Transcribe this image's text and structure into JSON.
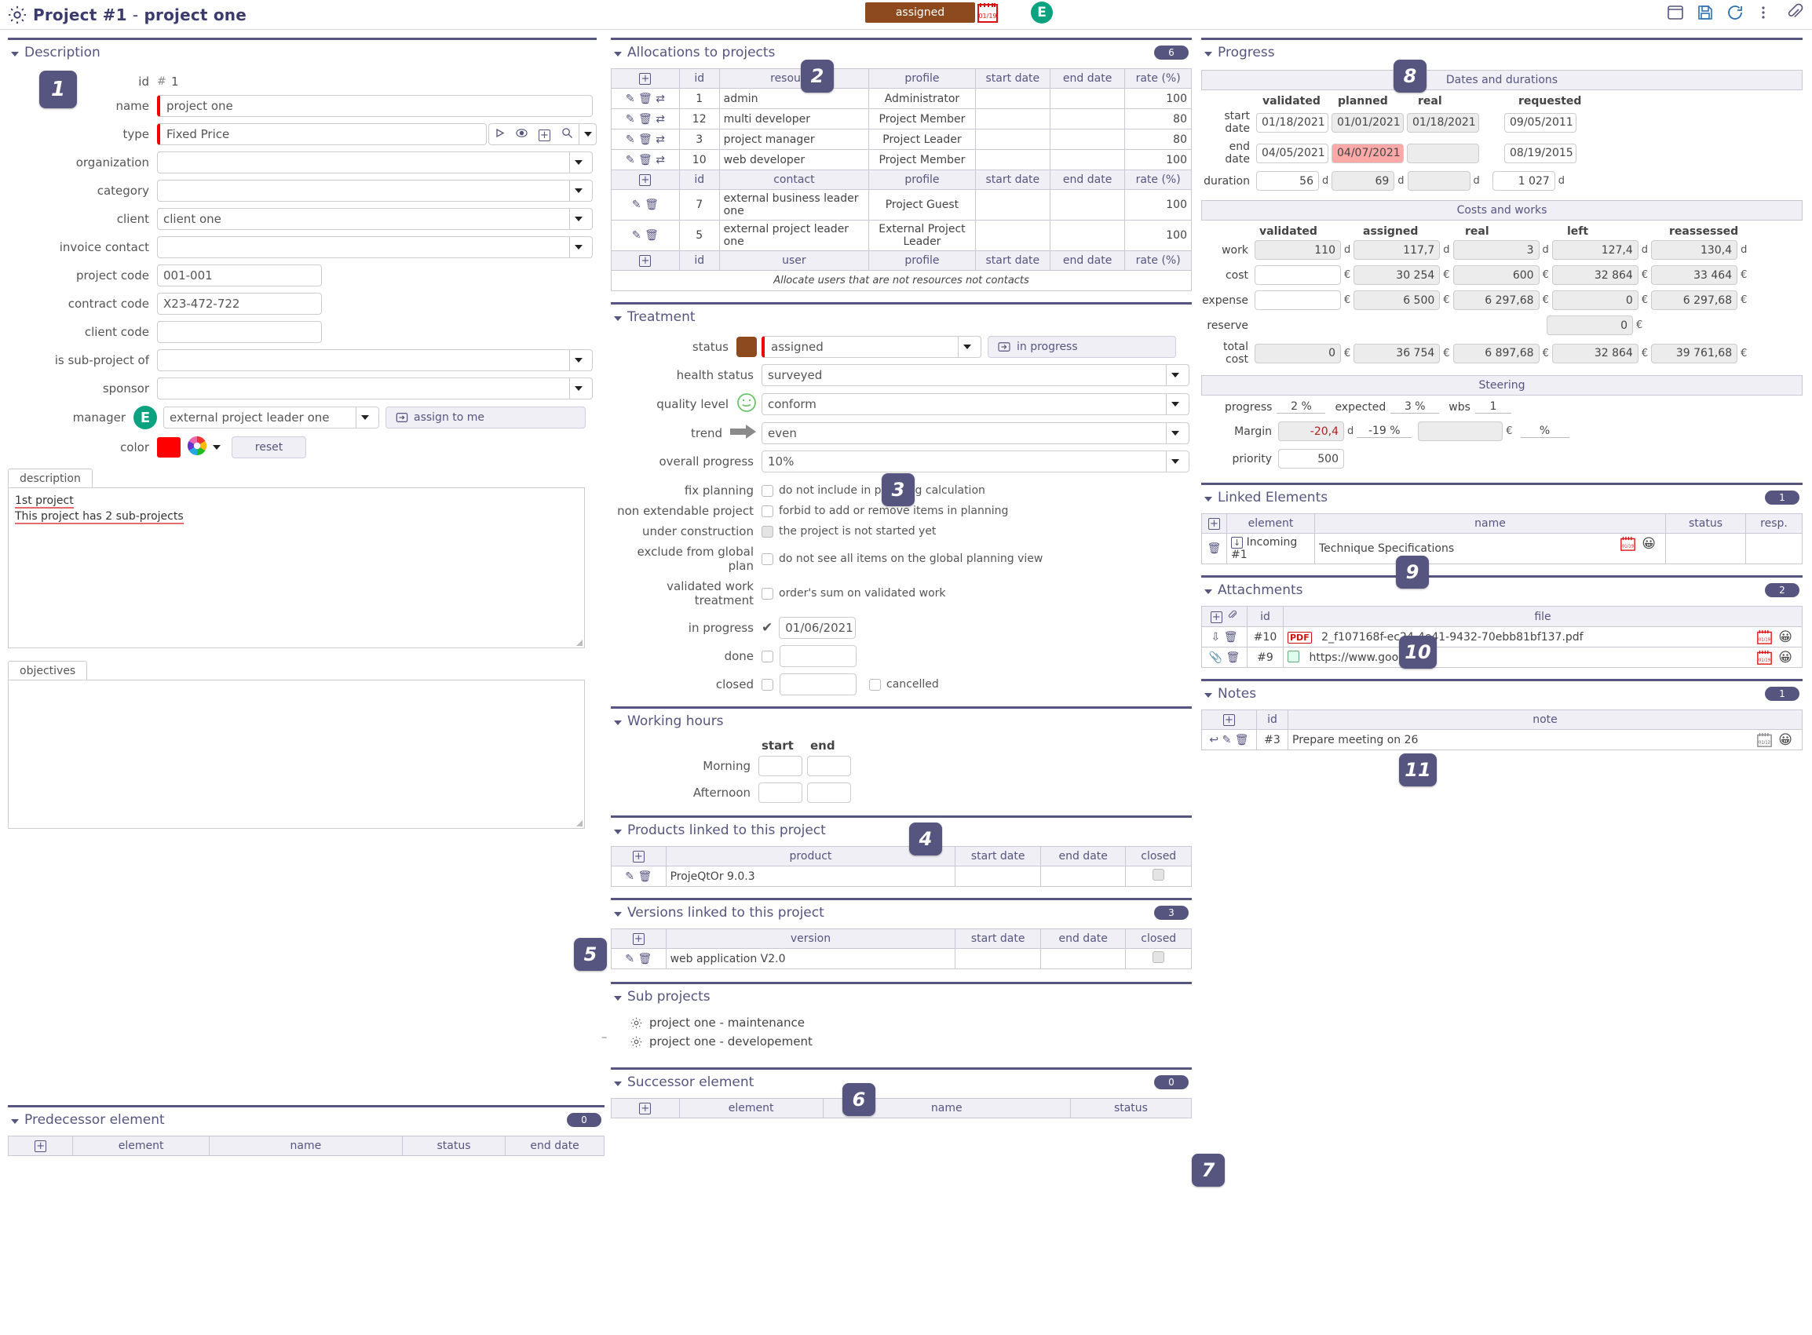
{
  "titlebar": {
    "title_main": "Project  #1",
    "title_sep": "-",
    "title_name": "project one",
    "status_chip": "assigned",
    "calendar_icon": "calendar-icon",
    "calendar_label": "01/19\n2021",
    "avatar_initial": "E",
    "icons": [
      "new-window-icon",
      "save-icon",
      "refresh-icon",
      "more-icon",
      "attach-icon"
    ]
  },
  "description": {
    "section_title": "Description",
    "step": "1",
    "id_label": "id",
    "id_hash": "#",
    "id_value": "1",
    "fields": [
      {
        "label": "name",
        "value": "project one",
        "required": true
      },
      {
        "label": "type",
        "value": "Fixed Price",
        "required": true
      },
      {
        "label": "organization",
        "value": ""
      },
      {
        "label": "category",
        "value": ""
      },
      {
        "label": "client",
        "value": "client one"
      },
      {
        "label": "invoice contact",
        "value": ""
      },
      {
        "label": "project code",
        "value": "001-001"
      },
      {
        "label": "contract code",
        "value": "X23-472-722"
      },
      {
        "label": "client code",
        "value": ""
      },
      {
        "label": "is sub-project of",
        "value": ""
      },
      {
        "label": "sponsor",
        "value": ""
      }
    ],
    "manager_label": "manager",
    "manager_avatar": "E",
    "manager_value": "external project leader one",
    "assign_to_me": "assign to me",
    "color_label": "color",
    "color_value": "#fe0000",
    "reset_label": "reset",
    "desc_tab": "description",
    "desc_line1": "1st project",
    "desc_line2": "This project has 2 sub-projects",
    "objectives_tab": "objectives",
    "objectives_text": ""
  },
  "allocations": {
    "section_title": "Allocations to projects",
    "step": "2",
    "count": "6",
    "resource_headers": [
      "",
      "id",
      "resource",
      "profile",
      "start date",
      "end date",
      "rate (%)"
    ],
    "resources": [
      {
        "id": "1",
        "name": "admin",
        "profile": "Administrator",
        "start": "",
        "end": "",
        "rate": "100"
      },
      {
        "id": "12",
        "name": "multi developer",
        "profile": "Project Member",
        "start": "",
        "end": "",
        "rate": "80"
      },
      {
        "id": "3",
        "name": "project manager",
        "profile": "Project Leader",
        "start": "",
        "end": "",
        "rate": "80"
      },
      {
        "id": "10",
        "name": "web developer",
        "profile": "Project Member",
        "start": "",
        "end": "",
        "rate": "100"
      }
    ],
    "contact_headers": [
      "",
      "id",
      "contact",
      "profile",
      "start date",
      "end date",
      "rate (%)"
    ],
    "contacts": [
      {
        "id": "7",
        "name": "external business leader one",
        "profile": "Project Guest",
        "start": "",
        "end": "",
        "rate": "100"
      },
      {
        "id": "5",
        "name": "external project leader one",
        "profile": "External Project Leader",
        "start": "",
        "end": "",
        "rate": "100"
      }
    ],
    "user_headers": [
      "",
      "id",
      "user",
      "profile",
      "start date",
      "end date",
      "rate (%)"
    ],
    "user_hint": "Allocate users that are not resources not contacts"
  },
  "treatment": {
    "section_title": "Treatment",
    "step": "3",
    "status_label": "status",
    "status_color": "#8c4a1e",
    "status_value": "assigned",
    "in_progress_chip": "in progress",
    "health_label": "health status",
    "health_value": "surveyed",
    "quality_label": "quality level",
    "quality_value": "conform",
    "trend_label": "trend",
    "trend_value": "even",
    "overall_label": "overall progress",
    "overall_value": "10%",
    "checks": [
      {
        "label": "fix planning",
        "text": "do not include in planning calculation",
        "checked": false,
        "grey": false
      },
      {
        "label": "non extendable project",
        "text": "forbid to add or remove items in planning",
        "checked": false,
        "grey": false
      },
      {
        "label": "under construction",
        "text": "the project is not started yet",
        "checked": false,
        "grey": true
      },
      {
        "label": "exclude from global plan",
        "text": "do not see all items on the global planning view",
        "checked": false,
        "grey": false
      },
      {
        "label": "validated work treatment",
        "text": "order's sum on validated work",
        "checked": false,
        "grey": false
      }
    ],
    "in_progress_label": "in progress",
    "in_progress_date": "01/06/2021",
    "in_progress_checked": true,
    "done_label": "done",
    "done_date": "",
    "closed_label": "closed",
    "closed_date": "",
    "cancelled_label": "cancelled"
  },
  "working_hours": {
    "section_title": "Working hours",
    "step": "4",
    "col_start": "start",
    "col_end": "end",
    "rows": [
      {
        "label": "Morning",
        "start": "",
        "end": ""
      },
      {
        "label": "Afternoon",
        "start": "",
        "end": ""
      }
    ]
  },
  "products": {
    "section_title": "Products linked to this project",
    "step": "5",
    "headers": [
      "",
      "product",
      "start date",
      "end date",
      "closed"
    ],
    "rows": [
      {
        "product": "ProjeQtOr 9.0.3",
        "start": "",
        "end": "",
        "closed": false
      }
    ]
  },
  "versions": {
    "section_title": "Versions linked to this project",
    "count": "3",
    "headers": [
      "",
      "version",
      "start date",
      "end date",
      "closed"
    ],
    "rows": [
      {
        "version": "web application V2.0",
        "start": "",
        "end": "",
        "closed": false
      }
    ]
  },
  "subprojects": {
    "section_title": "Sub projects",
    "step": "6",
    "items": [
      "project one - maintenance",
      "project one - developement"
    ]
  },
  "predecessor": {
    "section_title": "Predecessor element",
    "count": "0",
    "headers": [
      "",
      "element",
      "name",
      "status",
      "end date"
    ]
  },
  "successor": {
    "section_title": "Successor element",
    "step": "7",
    "count": "0",
    "headers": [
      "",
      "element",
      "name",
      "status"
    ]
  },
  "progress": {
    "section_title": "Progress",
    "step": "8",
    "dates_title": "Dates and durations",
    "dates_cols": [
      "validated",
      "planned",
      "real",
      "requested"
    ],
    "dates_rows": [
      {
        "label": "start date",
        "validated": "01/18/2021",
        "planned": "01/01/2021",
        "real": "01/18/2021",
        "requested": "09/05/2011",
        "planned_alert": false
      },
      {
        "label": "end date",
        "validated": "04/05/2021",
        "planned": "04/07/2021",
        "real": "",
        "requested": "08/19/2015",
        "planned_alert": true
      },
      {
        "label": "duration",
        "validated": "56",
        "planned": "69",
        "real": "",
        "requested": "1 027",
        "planned_alert": false,
        "unit": "d"
      }
    ],
    "costs_title": "Costs and works",
    "costs_cols": [
      "validated",
      "assigned",
      "real",
      "left",
      "reassessed"
    ],
    "costs_rows": [
      {
        "label": "work",
        "unit": "d",
        "validated": "110",
        "assigned": "117,7",
        "real": "3",
        "left": "127,4",
        "reassessed": "130,4",
        "validated_grey": true
      },
      {
        "label": "cost",
        "unit": "€",
        "validated": "",
        "assigned": "30 254",
        "real": "600",
        "left": "32 864",
        "reassessed": "33 464",
        "validated_grey": false
      },
      {
        "label": "expense",
        "unit": "€",
        "validated": "",
        "assigned": "6 500",
        "real": "6 297,68",
        "left": "0",
        "reassessed": "6 297,68",
        "validated_grey": false
      },
      {
        "label": "reserve",
        "unit": "€",
        "validated": null,
        "assigned": null,
        "real": null,
        "left": "0",
        "reassessed": null,
        "validated_grey": false
      },
      {
        "label": "total cost",
        "unit": "€",
        "validated": "0",
        "assigned": "36 754",
        "real": "6 897,68",
        "left": "32 864",
        "reassessed": "39 761,68",
        "validated_grey": true
      }
    ],
    "steering_title": "Steering",
    "progress_label": "progress",
    "progress_value": "2 %",
    "expected_label": "expected",
    "expected_value": "3 %",
    "wbs_label": "wbs",
    "wbs_value": "1",
    "margin_label": "Margin",
    "margin_days": "-20,4",
    "margin_days_unit": "d",
    "margin_pct": "-19 %",
    "margin_money": "",
    "margin_money_unit": "€",
    "margin_pct2_unit": "%",
    "priority_label": "priority",
    "priority_value": "500"
  },
  "linked_elements": {
    "section_title": "Linked Elements",
    "step": "9",
    "count": "1",
    "headers": [
      "",
      "element",
      "name",
      "status",
      "resp."
    ],
    "rows": [
      {
        "element": "Incoming #1",
        "name": "Technique Specifications",
        "date_badge": "01/19",
        "status": "",
        "resp": ""
      }
    ]
  },
  "attachments": {
    "section_title": "Attachments",
    "step": "10",
    "count": "2",
    "headers": [
      "",
      "id",
      "file"
    ],
    "rows": [
      {
        "id": "#10",
        "file": "2_f107168f-ec24-4e41-9432-70ebb81bf137.pdf",
        "kind": "pdf",
        "date_badge": "01/19"
      },
      {
        "id": "#9",
        "file": "https://www.google.fr",
        "kind": "link",
        "date_badge": "01/19"
      }
    ]
  },
  "notes": {
    "section_title": "Notes",
    "step": "11",
    "count": "1",
    "headers": [
      "",
      "id",
      "note"
    ],
    "rows": [
      {
        "id": "#3",
        "note": "Prepare meeting on 26",
        "date_badge": "01/12"
      }
    ]
  }
}
